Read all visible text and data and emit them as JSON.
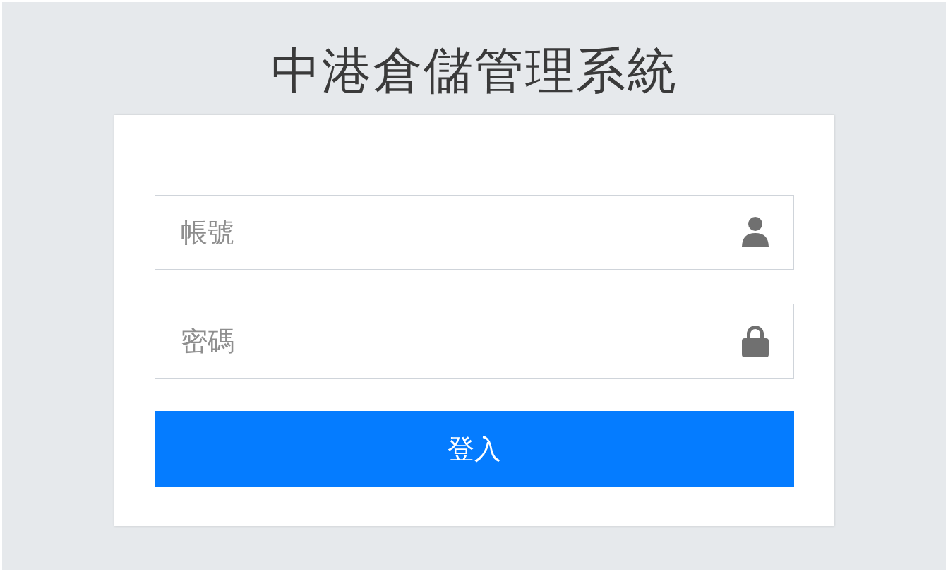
{
  "title": "中港倉儲管理系統",
  "fields": [
    {
      "placeholder": "帳號",
      "kind": "user"
    },
    {
      "placeholder": "密碼",
      "kind": "lock"
    }
  ],
  "login_button": {
    "label": "登入"
  }
}
